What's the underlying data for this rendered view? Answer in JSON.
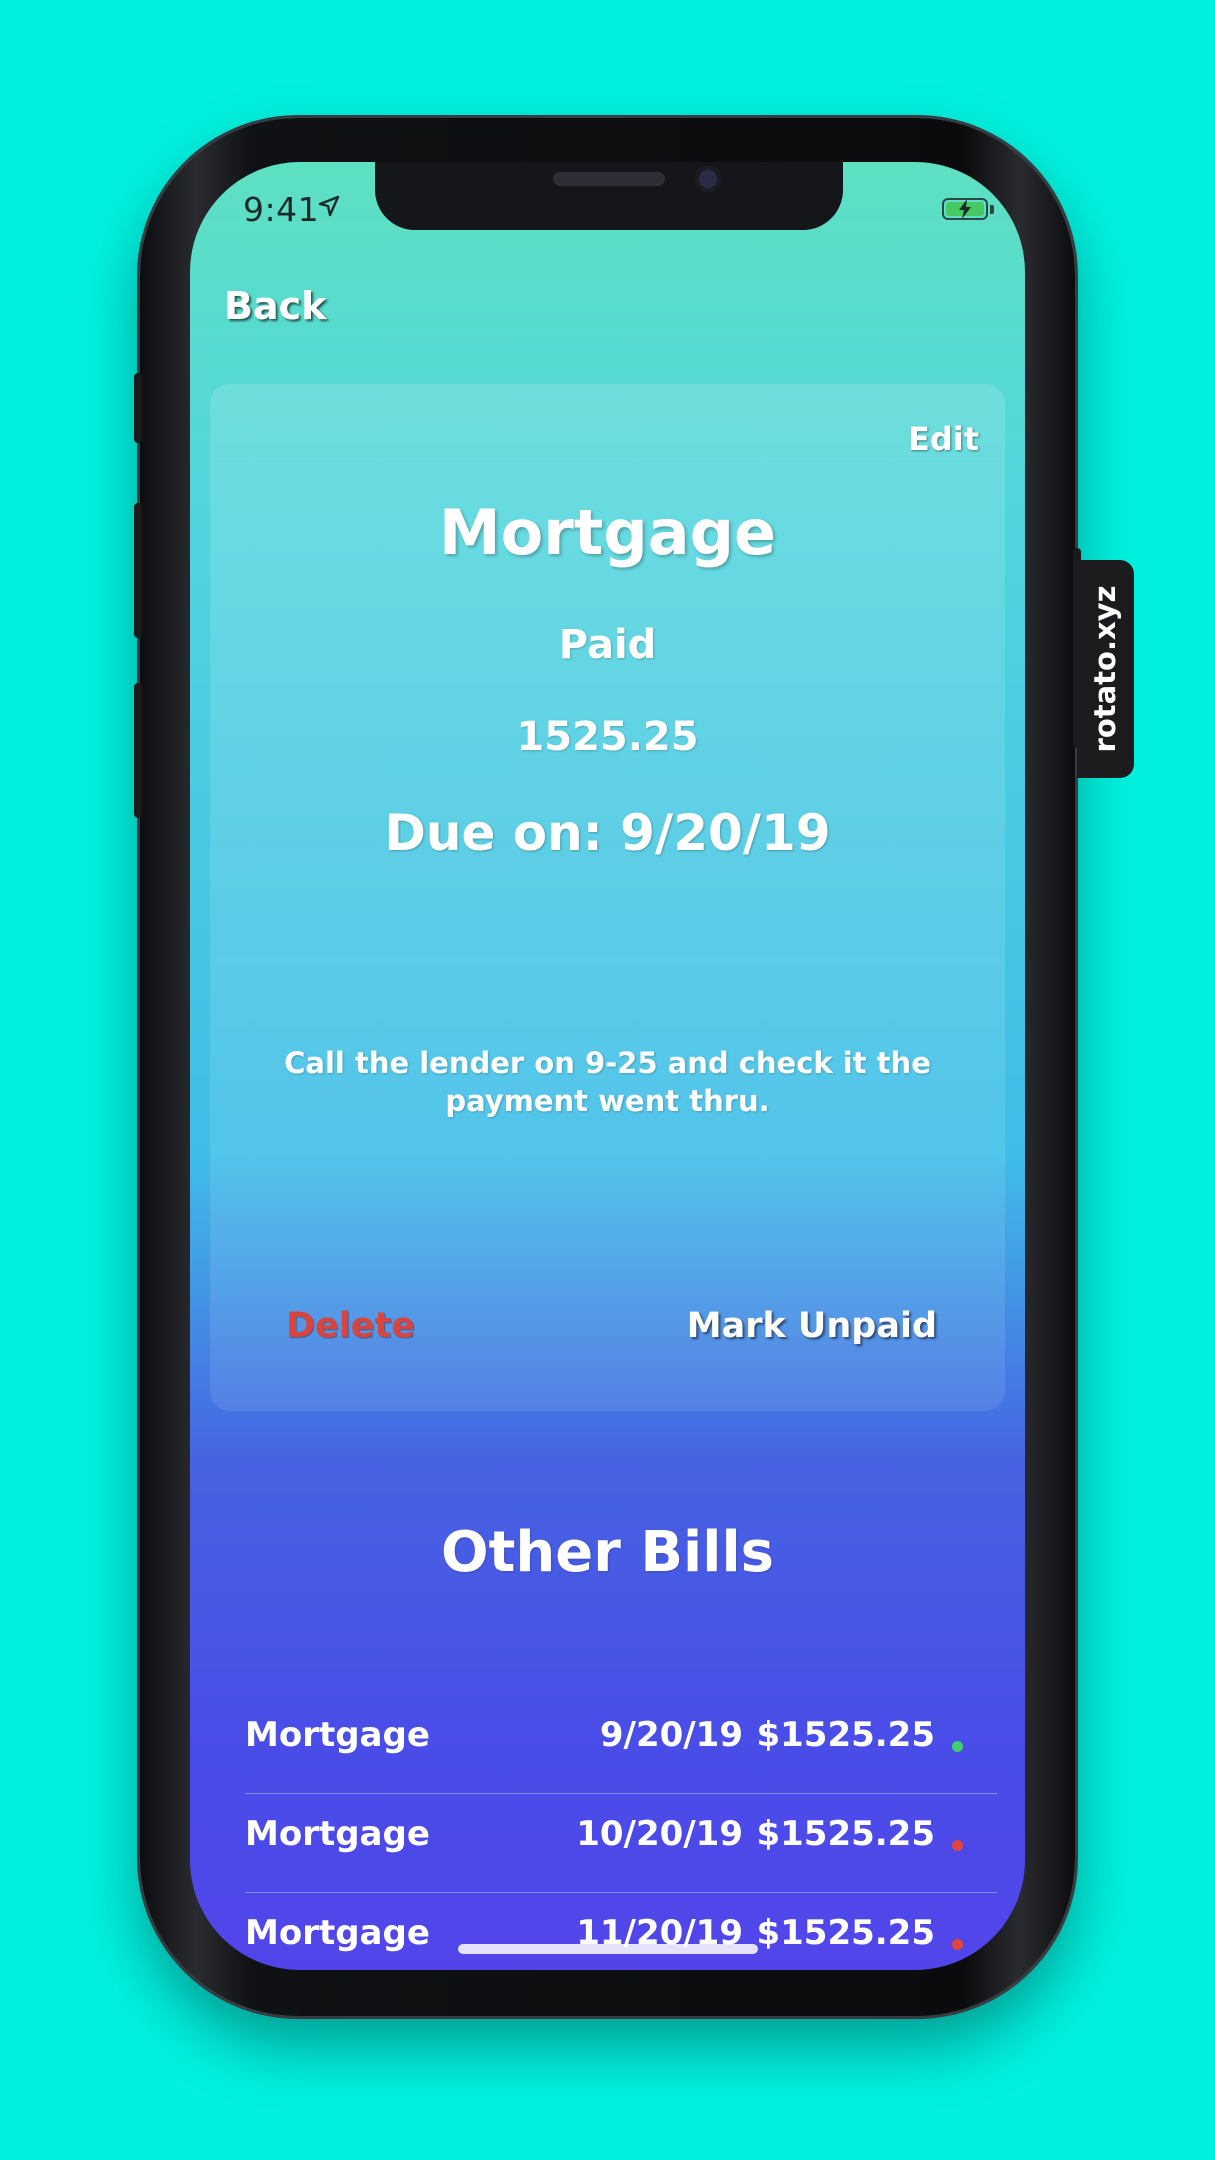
{
  "status_bar": {
    "time": "9:41"
  },
  "nav": {
    "back_label": "Back"
  },
  "detail": {
    "edit_label": "Edit",
    "title": "Mortgage",
    "status": "Paid",
    "amount": "1525.25",
    "due": "Due on: 9/20/19",
    "note": "Call the lender on 9-25 and check it the payment went thru.",
    "delete_label": "Delete",
    "mark_label": "Mark Unpaid"
  },
  "other": {
    "title": "Other Bills",
    "bills": [
      {
        "name": "Mortgage",
        "date": "9/20/19",
        "amount": "$1525.25",
        "status": "paid",
        "status_color": "#3ecf6e"
      },
      {
        "name": "Mortgage",
        "date": "10/20/19",
        "amount": "$1525.25",
        "status": "unpaid",
        "status_color": "#e0453f"
      },
      {
        "name": "Mortgage",
        "date": "11/20/19",
        "amount": "$1525.25",
        "status": "unpaid",
        "status_color": "#e0453f"
      }
    ]
  },
  "watermark": {
    "text": "rotato.xyz"
  },
  "colors": {
    "background": "#00f0de",
    "delete": "#d9443f"
  }
}
